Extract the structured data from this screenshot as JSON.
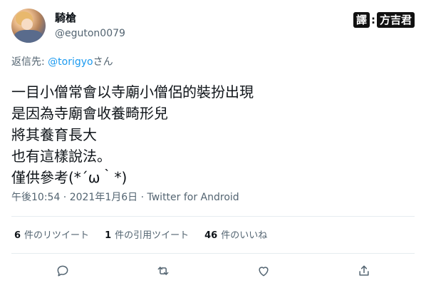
{
  "user": {
    "display_name": "騎槍",
    "handle": "@eguton0079"
  },
  "translator_badge": {
    "label_1": "譯",
    "separator": ":",
    "label_2": "方吉君"
  },
  "reply_to": {
    "prefix": "返信先: ",
    "mention": "@torigyo",
    "suffix": "さん"
  },
  "tweet": {
    "lines": [
      "一目小僧常會以寺廟小僧侶的裝扮出現",
      "是因為寺廟會收養畸形兒",
      "將其養育長大",
      "也有這樣說法。",
      "僅供參考(*´ω｀*)"
    ]
  },
  "meta": {
    "text": "午後10:54 · 2021年1月6日 · Twitter for Android"
  },
  "stats": {
    "retweets": {
      "count": "6",
      "label": "件のリツイート"
    },
    "quotes": {
      "count": "1",
      "label": "件の引用ツイート"
    },
    "likes": {
      "count": "46",
      "label": "件のいいね"
    }
  },
  "actions": {
    "icons": [
      "reply-icon",
      "retweet-icon",
      "like-icon",
      "share-icon"
    ]
  },
  "colors": {
    "text": "#0f1419",
    "secondary": "#536471",
    "link": "#1d9bf0",
    "divider": "#e6ecf0"
  }
}
